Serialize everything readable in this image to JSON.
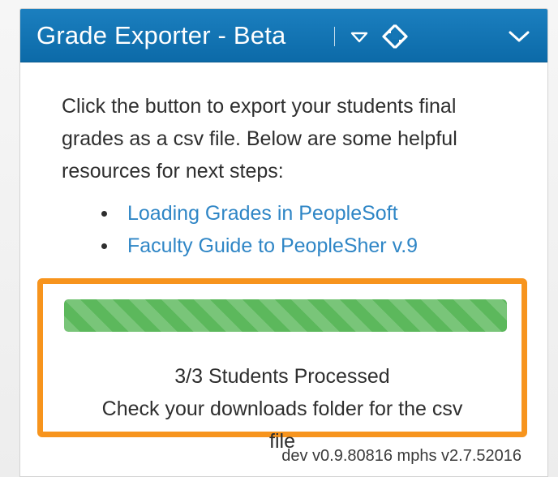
{
  "header": {
    "title": "Grade Exporter - Beta",
    "icons": {
      "caret": "caret-down-icon",
      "move": "move-icon",
      "collapse": "chevron-down-icon"
    },
    "colors": {
      "background": "#1476b6",
      "text": "#ffffff"
    }
  },
  "body": {
    "intro": "Click the button to export your students final grades as a csv file. Below are some helpful resources for next steps:",
    "links": [
      {
        "label": "Loading Grades in PeopleSoft"
      },
      {
        "label": "Faculty Guide to PeopleSher v.9"
      }
    ],
    "link_color": "#2f86c6"
  },
  "status": {
    "progress_percent": 100,
    "progress_color": "#5cb85c",
    "highlight_color": "#f7941d",
    "processed": "3/3 Students Processed",
    "message_line1": "Check your downloads folder for the csv",
    "message_line2": "file"
  },
  "footer": {
    "version": "dev v0.9.80816 mphs v2.7.52016"
  }
}
